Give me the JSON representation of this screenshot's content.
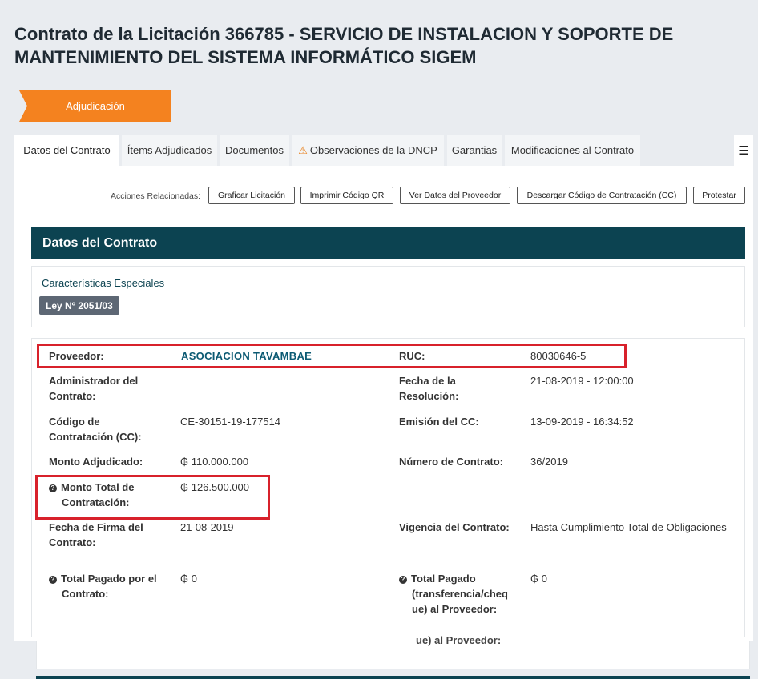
{
  "page": {
    "title": "Contrato de la Licitación 366785 - SERVICIO DE INSTALACION Y SOPORTE DE MANTENIMIENTO DEL SISTEMA INFORMÁTICO SIGEM",
    "phase": "Adjudicación"
  },
  "tabs": [
    {
      "label": "Datos del Contrato"
    },
    {
      "label": "Ítems Adjudicados"
    },
    {
      "label": "Documentos"
    },
    {
      "label": "Observaciones de la DNCP"
    },
    {
      "label": "Garantias"
    },
    {
      "label": "Modificaciones al Contrato"
    }
  ],
  "tab_menu_icon": "hamburger-icon",
  "actions": {
    "label": "Acciones Relacionadas:",
    "buttons": [
      {
        "label": "Graficar Licitación"
      },
      {
        "label": "Imprimir Código QR"
      },
      {
        "label": "Ver Datos del Proveedor"
      },
      {
        "label": "Descargar Código de Contratación (CC)"
      },
      {
        "label": "Protestar"
      }
    ]
  },
  "section": {
    "title": "Datos del Contrato",
    "special_label": "Características Especiales",
    "law_badge": "Ley Nº 2051/03"
  },
  "fields": {
    "proveedor_label": "Proveedor:",
    "proveedor_value": "ASOCIACION TAVAMBAE",
    "ruc_label": "RUC:",
    "ruc_value": "80030646-5",
    "admin_label_1": "Administrador del",
    "admin_label_2": "Contrato:",
    "fecha_res_label_1": "Fecha de la",
    "fecha_res_label_2": "Resolución:",
    "fecha_res_value": "21-08-2019 - 12:00:00",
    "codigo_label_1": "Código de",
    "codigo_label_2": "Contratación (CC):",
    "codigo_value": "CE-30151-19-177514",
    "emision_label": "Emisión del CC:",
    "emision_value": "13-09-2019 - 16:34:52",
    "monto_adj_label": "Monto Adjudicado:",
    "monto_adj_value": "₲ 110.000.000",
    "num_contrato_label": "Número de Contrato:",
    "num_contrato_value": "36/2019",
    "monto_total_label_1": "Monto Total de",
    "monto_total_label_2": "Contratación:",
    "monto_total_value": "₲ 126.500.000",
    "fecha_firma_label_1": "Fecha de Firma del",
    "fecha_firma_label_2": "Contrato:",
    "fecha_firma_value": "21-08-2019",
    "vigencia_label": "Vigencia del Contrato:",
    "vigencia_value": "Hasta Cumplimiento Total de Obligaciones",
    "total_pagado_label_1": "Total Pagado por el",
    "total_pagado_label_2": "Contrato:",
    "total_pagado_value": "₲ 0",
    "total_pagado_prov_label_1": "Total Pagado",
    "total_pagado_prov_label_2": "(transferencia/cheq",
    "total_pagado_prov_label_3": "ue) al Proveedor:",
    "total_pagado_prov_value": "₲ 0",
    "ghost_text": "ue) al Proveedor:"
  },
  "colors": {
    "accent_orange": "#f4821f",
    "header_teal": "#0c4351",
    "highlight_red": "#d8212b"
  }
}
